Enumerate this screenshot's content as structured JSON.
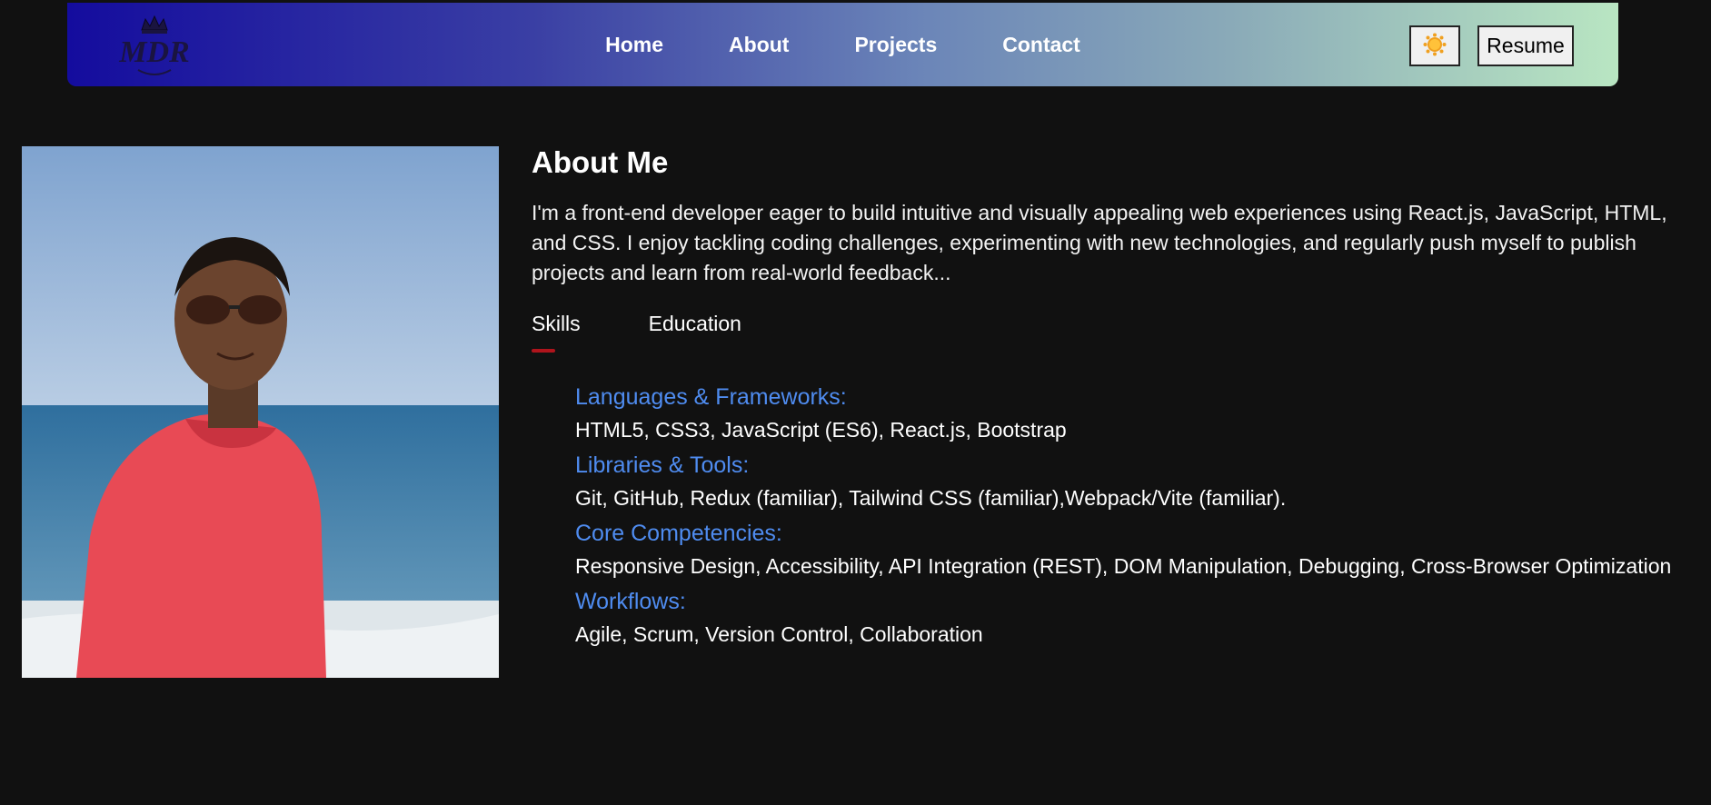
{
  "nav": {
    "logo_text": "MDR",
    "links": [
      "Home",
      "About",
      "Projects",
      "Contact"
    ],
    "theme_icon": "sun-icon",
    "resume_label": "Resume"
  },
  "about": {
    "title": "About Me",
    "bio": "I'm a front-end developer eager to build intuitive and visually appealing web experiences using React.js, JavaScript, HTML, and CSS. I enjoy tackling coding challenges, experimenting with new technologies, and regularly push myself to publish projects and learn from real-world feedback...",
    "tabs": [
      "Skills",
      "Education"
    ],
    "active_tab": "Skills",
    "skills": [
      {
        "heading": "Languages & Frameworks:",
        "items": "HTML5, CSS3, JavaScript (ES6), React.js, Bootstrap"
      },
      {
        "heading": "Libraries & Tools:",
        "items": "Git, GitHub, Redux (familiar), Tailwind CSS (familiar),Webpack/Vite (familiar)."
      },
      {
        "heading": "Core Competencies:",
        "items": "Responsive Design, Accessibility, API Integration (REST), DOM Manipulation, Debugging, Cross-Browser Optimization"
      },
      {
        "heading": "Workflows:",
        "items": "Agile, Scrum, Version Control, Collaboration"
      }
    ]
  },
  "colors": {
    "background": "#111111",
    "accent_blue": "#4f8cf0",
    "tab_underline": "#b0141c"
  }
}
